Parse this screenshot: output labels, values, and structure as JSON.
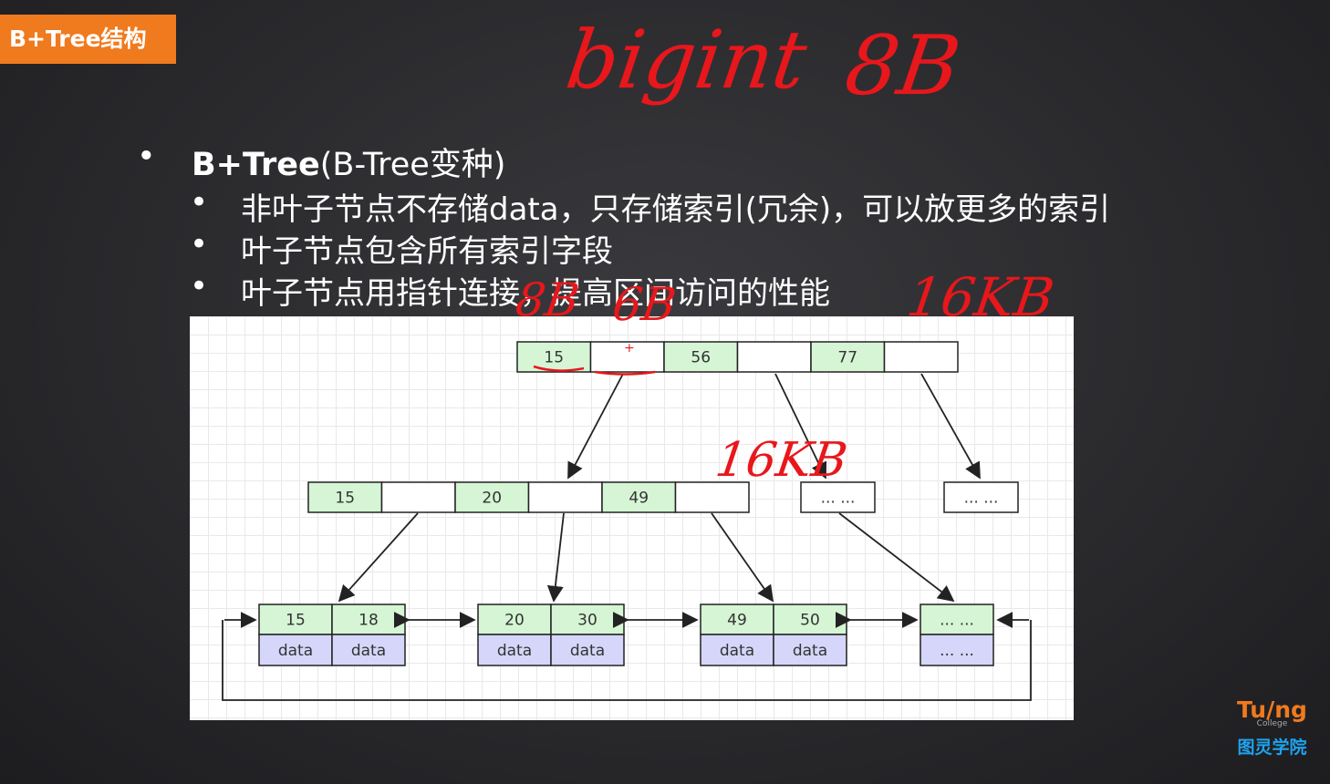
{
  "badge": "B+Tree结构",
  "bullets": {
    "main_bold": "B+Tree",
    "main_rest": "(B-Tree变种)",
    "items": [
      "非叶子节点不存储data，只存储索引(冗余)，可以放更多的索引",
      "叶子节点包含所有索引字段",
      "叶子节点用指针连接，提高区间访问的性能"
    ]
  },
  "annotations": {
    "bigint": "bigint",
    "eight_b": "8B",
    "key_size": "8B",
    "ptr_size": "6B",
    "page_size_top": "16KB",
    "page_size_mid": "16KB",
    "plus": "+"
  },
  "tree": {
    "root_keys": [
      "15",
      "",
      "56",
      "",
      "77",
      ""
    ],
    "mid_keys": [
      "15",
      "",
      "20",
      "",
      "49",
      ""
    ],
    "other_mid": [
      "... ...",
      "... ..."
    ],
    "leaves": [
      {
        "keys": [
          "15",
          "18"
        ],
        "data": [
          "data",
          "data"
        ]
      },
      {
        "keys": [
          "20",
          "30"
        ],
        "data": [
          "data",
          "data"
        ]
      },
      {
        "keys": [
          "49",
          "50"
        ],
        "data": [
          "data",
          "data"
        ]
      },
      {
        "keys": [
          "... ..."
        ],
        "data": [
          "... ..."
        ]
      }
    ],
    "colors": {
      "key": "#d5f5d5",
      "data": "#d6d6fb",
      "border": "#222222"
    }
  },
  "logo": {
    "brand": "Tu/ng",
    "sub": "College",
    "cn": "图灵学院"
  }
}
